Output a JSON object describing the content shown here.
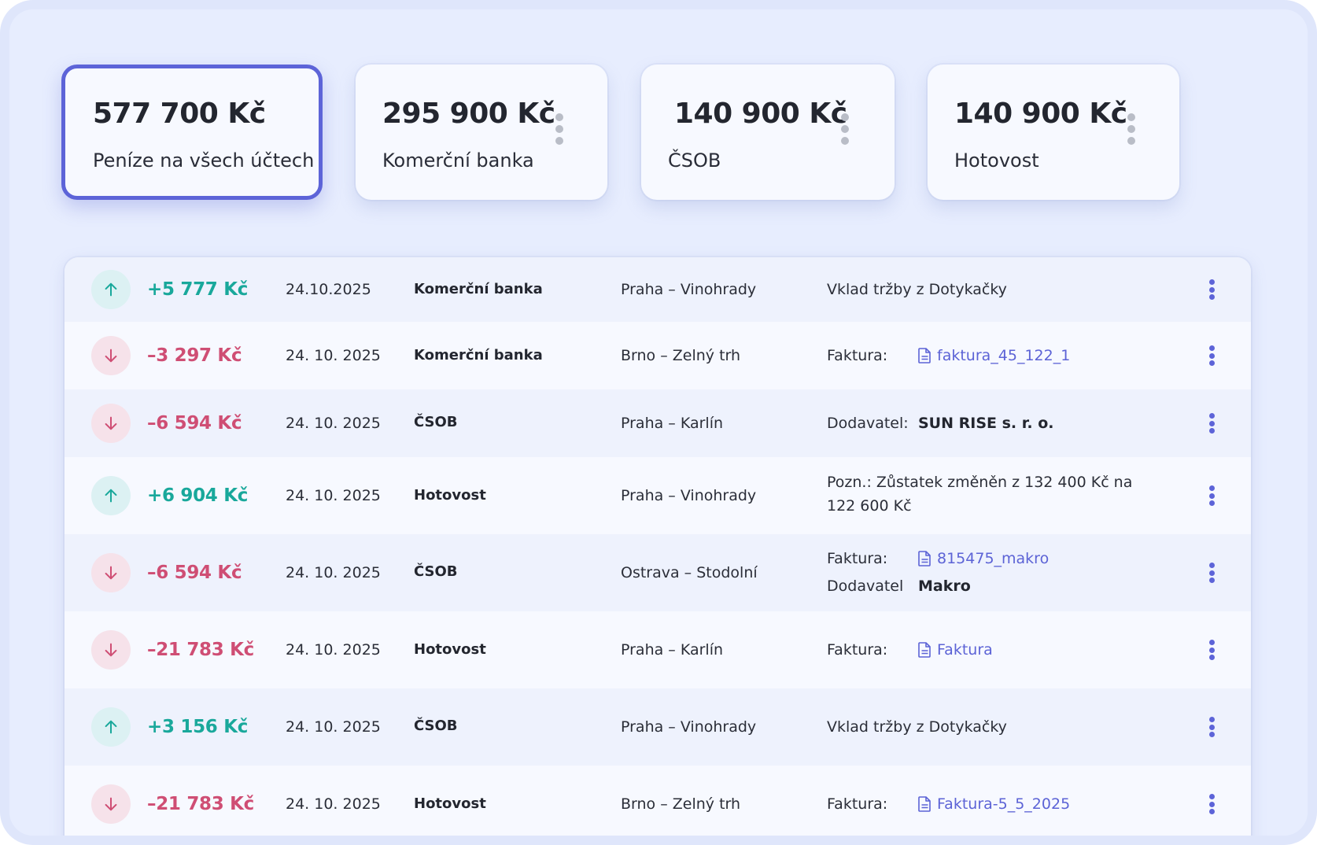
{
  "cards": [
    {
      "amount": "577 700 Kč",
      "name": "Peníze na všech účtech"
    },
    {
      "amount": "295 900 Kč",
      "name": "Komerční banka"
    },
    {
      "amount": "140 900 Kč",
      "name": "ČSOB"
    },
    {
      "amount": "140 900 Kč",
      "name": "Hotovost"
    }
  ],
  "transactions": [
    {
      "direction": "in",
      "amount": "+5 777 Kč",
      "date": "24.10.2025",
      "account": "Komerční banka",
      "place": "Praha – Vinohrady",
      "note": "Vklad tržby z Dotykačky"
    },
    {
      "direction": "out",
      "amount": "–3 297 Kč",
      "date": "24. 10. 2025",
      "account": "Komerční banka",
      "place": "Brno – Zelný trh",
      "invoice_label": "Faktura:",
      "invoice_file": "faktura_45_122_1"
    },
    {
      "direction": "out",
      "amount": "–6 594 Kč",
      "date": "24. 10. 2025",
      "account": "ČSOB",
      "place": "Praha – Karlín",
      "supplier_label": "Dodavatel:",
      "supplier": "SUN RISE s. r. o."
    },
    {
      "direction": "in",
      "amount": "+6 904 Kč",
      "date": "24. 10. 2025",
      "account": "Hotovost",
      "place": "Praha – Vinohrady",
      "note": "Pozn.: Zůstatek změněn z 132 400 Kč na 122 600 Kč"
    },
    {
      "direction": "out",
      "amount": "–6 594 Kč",
      "date": "24. 10. 2025",
      "account": "ČSOB",
      "place": "Ostrava – Stodolní",
      "invoice_label": "Faktura:",
      "invoice_file": "815475_makro",
      "supplier_label": "Dodavatel",
      "supplier": "Makro"
    },
    {
      "direction": "out",
      "amount": "–21 783 Kč",
      "date": "24. 10. 2025",
      "account": "Hotovost",
      "place": "Praha – Karlín",
      "invoice_label": "Faktura:",
      "invoice_file": "Faktura"
    },
    {
      "direction": "in",
      "amount": "+3 156 Kč",
      "date": "24. 10. 2025",
      "account": "ČSOB",
      "place": "Praha – Vinohrady",
      "note": "Vklad tržby z Dotykačky"
    },
    {
      "direction": "out",
      "amount": "–21 783 Kč",
      "date": "24. 10. 2025",
      "account": "Hotovost",
      "place": "Brno – Zelný trh",
      "invoice_label": "Faktura:",
      "invoice_file": "Faktura-5_5_2025"
    }
  ],
  "colors": {
    "accent": "#5d64d8",
    "income": "#19a89b",
    "expense": "#cf4e74",
    "background": "#e7edfe"
  },
  "icons": {
    "card_menu": "kebab-vertical-icon",
    "row_menu": "kebab-vertical-icon",
    "income": "arrow-up-icon",
    "expense": "arrow-down-icon",
    "file": "document-icon"
  }
}
